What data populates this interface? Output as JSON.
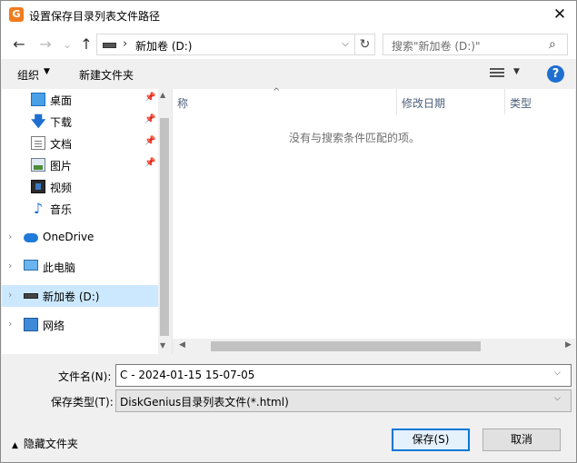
{
  "title_bar": {
    "app_icon_glyph": "G",
    "title": "设置保存目录列表文件路径",
    "close_glyph": "✕"
  },
  "nav": {
    "back_glyph": "←",
    "forward_glyph": "→",
    "recent_glyph": "⌄",
    "up_glyph": "↑",
    "address_separator": "›",
    "address_text": "新加卷 (D:)",
    "address_drop_glyph": "⌵",
    "refresh_glyph": "↻",
    "search_placeholder": "搜索\"新加卷 (D:)\"",
    "search_glyph": "⌕"
  },
  "toolbar": {
    "organize_label": "组织",
    "organize_arrow": "▼",
    "new_folder_label": "新建文件夹",
    "view_arrow": "▼",
    "help_glyph": "?"
  },
  "sidebar": {
    "quick_access": [
      {
        "label": "桌面",
        "icon": "desktop-icon",
        "pin": "📌"
      },
      {
        "label": "下载",
        "icon": "download-icon",
        "pin": "📌"
      },
      {
        "label": "文档",
        "icon": "document-icon",
        "pin": "📌"
      },
      {
        "label": "图片",
        "icon": "pictures-icon",
        "pin": "📌"
      },
      {
        "label": "视频",
        "icon": "video-icon"
      },
      {
        "label": "音乐",
        "icon": "music-icon"
      }
    ],
    "roots": [
      {
        "label": "OneDrive",
        "icon": "onedrive-icon"
      },
      {
        "label": "此电脑",
        "icon": "this-pc-icon"
      },
      {
        "label": "新加卷 (D:)",
        "icon": "drive-icon",
        "selected": true
      },
      {
        "label": "网络",
        "icon": "network-icon"
      }
    ],
    "expand_glyph": "›",
    "download_glyph": "🡇",
    "music_glyph": "♪",
    "scroll_up": "▲",
    "scroll_down": "▼"
  },
  "file_list": {
    "columns": [
      "称",
      "修改日期",
      "类型"
    ],
    "sort_glyph": "^",
    "empty_message": "没有与搜索条件匹配的项。",
    "scroll_left": "◀",
    "scroll_right": "▶"
  },
  "form": {
    "filename_label": "文件名(N):",
    "filename_value": "C - 2024-01-15 15-07-05",
    "filetype_label": "保存类型(T):",
    "filetype_value": "DiskGenius目录列表文件(*.html)",
    "drop_glyph": "⌵"
  },
  "footer": {
    "hide_folders_arrow": "▲",
    "hide_folders_label": "隐藏文件夹",
    "save_label": "保存(S)",
    "cancel_label": "取消"
  },
  "colors": {
    "selection": "#cce8ff",
    "accent": "#0078d7",
    "help": "#1f6fd1",
    "app_icon": "#f07c1e"
  }
}
